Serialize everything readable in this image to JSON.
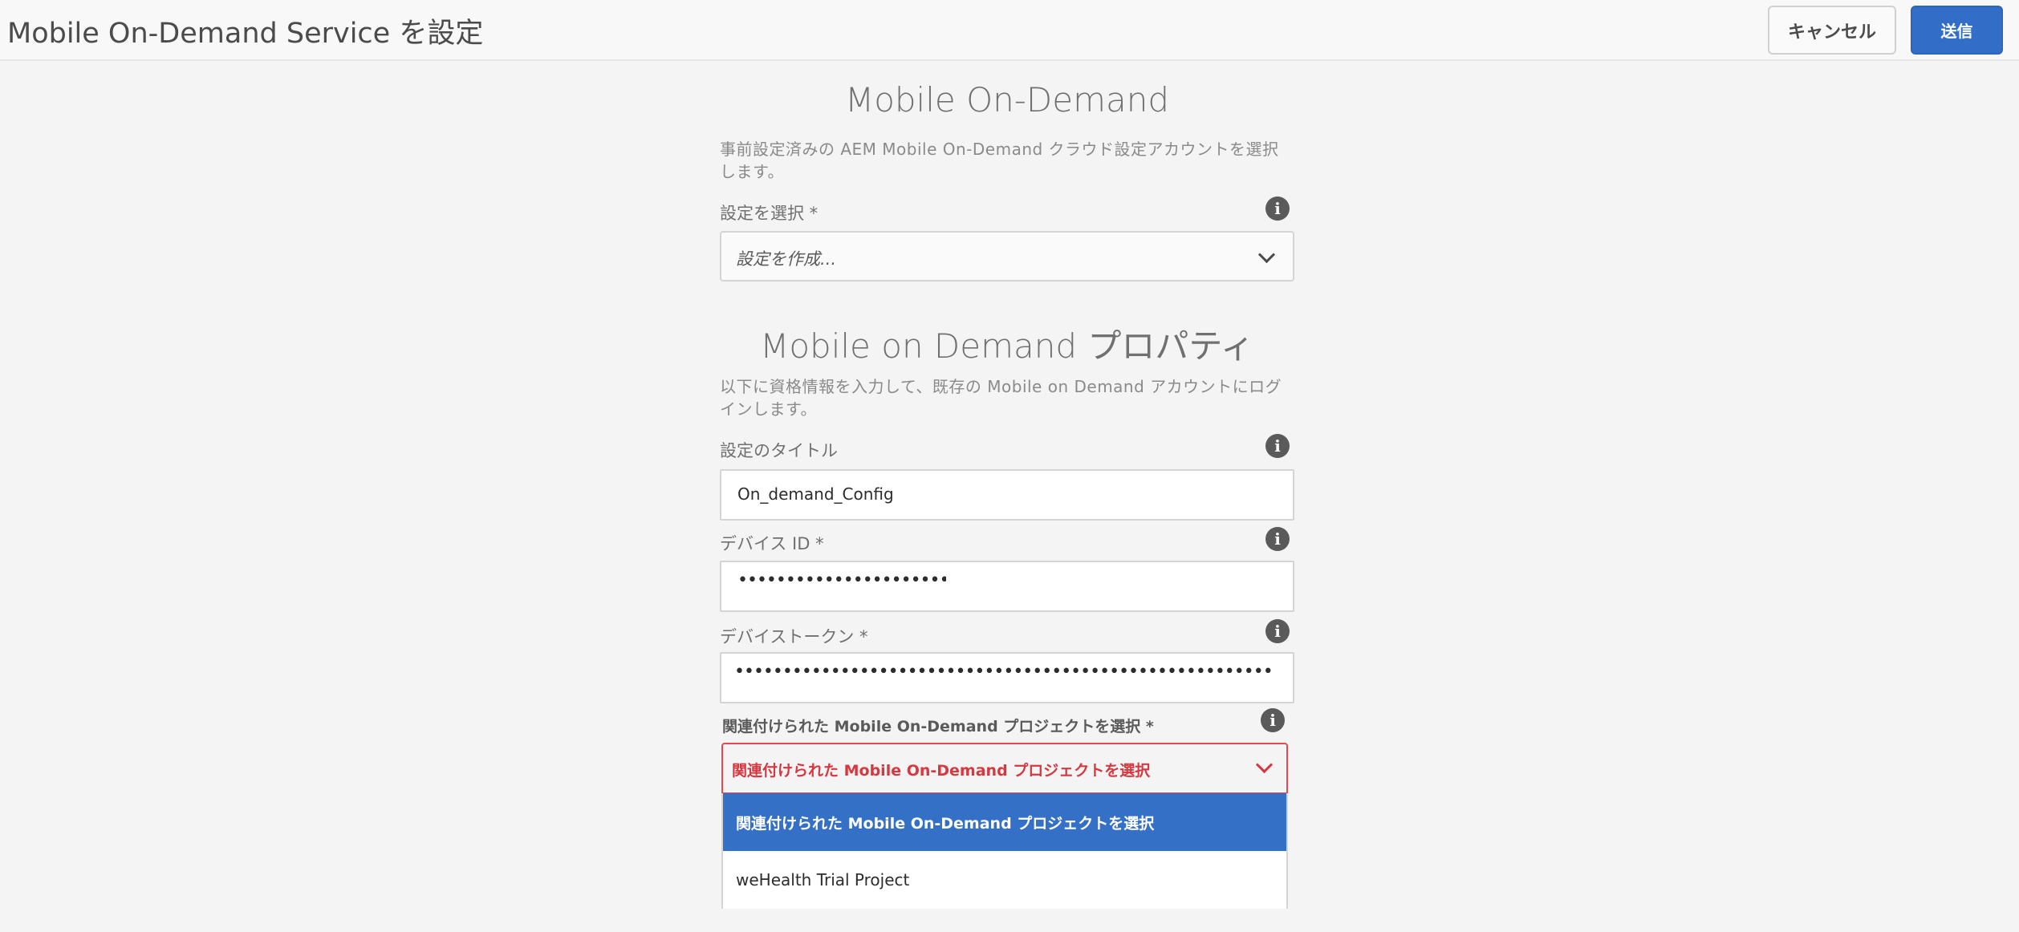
{
  "header": {
    "title": "Mobile On-Demand Service を設定",
    "cancel_label": "キャンセル",
    "submit_label": "送信"
  },
  "section1": {
    "title": "Mobile On-Demand",
    "description": "事前設定済みの AEM Mobile On-Demand クラウド設定アカウントを選択します。",
    "config_label": "設定を選択 *",
    "config_value": "設定を作成..."
  },
  "section2": {
    "title": "Mobile on Demand プロパティ",
    "description": "以下に資格情報を入力して、既存の Mobile on Demand アカウントにログインします。",
    "config_title_label": "設定のタイトル",
    "config_title_value": "On_demand_Config",
    "device_id_label": "デバイス ID *",
    "device_id_value": "••••••••••••••••••••••••••••••••••••••",
    "device_token_label": "デバイストークン *",
    "device_token_value": "••••••••••••••••••••••••••••••••••••••••••••••••••••••••••••••••••••••••••••••••••••••••••••••••••••••",
    "project_label": "関連付けられた Mobile On-Demand プロジェクトを選択 *",
    "project_value": "関連付けられた Mobile On-Demand プロジェクトを選択",
    "project_options": [
      "関連付けられた Mobile On-Demand プロジェクトを選択",
      "weHealth Trial Project"
    ]
  },
  "icons": {
    "info": "info-icon",
    "dropdown": "chevron-down-icon"
  },
  "colors": {
    "accent": "#326ec8",
    "error": "#d7373f"
  }
}
